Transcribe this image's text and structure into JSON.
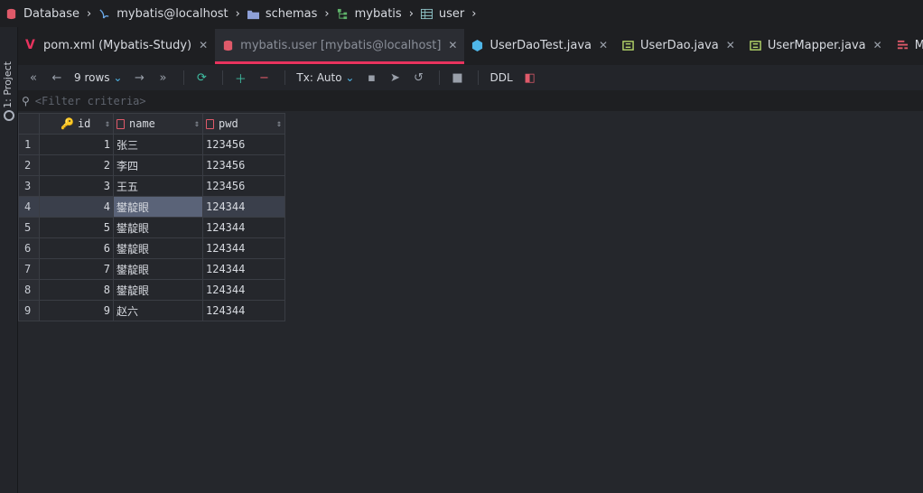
{
  "breadcrumb": {
    "items": [
      {
        "label": "Database",
        "icon": "database-icon"
      },
      {
        "label": "mybatis@localhost",
        "icon": "datasource-icon"
      },
      {
        "label": "schemas",
        "icon": "folder-icon"
      },
      {
        "label": "mybatis",
        "icon": "schema-icon"
      },
      {
        "label": "user",
        "icon": "table-icon"
      }
    ]
  },
  "sidebar": {
    "project_label": "1: Project"
  },
  "tabs": [
    {
      "label": "pom.xml (Mybatis-Study)",
      "icon": "maven-icon",
      "active": false
    },
    {
      "label": "mybatis.user [mybatis@localhost]",
      "icon": "database-icon",
      "active": true
    },
    {
      "label": "UserDaoTest.java",
      "icon": "java-test-icon",
      "active": false
    },
    {
      "label": "UserDao.java",
      "icon": "interface-icon",
      "active": false
    },
    {
      "label": "UserMapper.java",
      "icon": "interface-icon",
      "active": false
    },
    {
      "label": "Mybatis-config.xml",
      "icon": "xml-icon",
      "active": false
    }
  ],
  "toolbar": {
    "rows_label": "9 rows",
    "tx_label": "Tx: Auto",
    "ddl_label": "DDL"
  },
  "filter": {
    "placeholder": "<Filter criteria>"
  },
  "grid": {
    "columns": [
      {
        "name": "id",
        "icon": "key-icon"
      },
      {
        "name": "name",
        "icon": "column-icon"
      },
      {
        "name": "pwd",
        "icon": "column-icon"
      }
    ],
    "rows": [
      {
        "n": "1",
        "id": "1",
        "name": "张三",
        "pwd": "123456"
      },
      {
        "n": "2",
        "id": "2",
        "name": "李四",
        "pwd": "123456"
      },
      {
        "n": "3",
        "id": "3",
        "name": "王五",
        "pwd": "123456"
      },
      {
        "n": "4",
        "id": "4",
        "name": "鐢靛眼",
        "pwd": "124344"
      },
      {
        "n": "5",
        "id": "5",
        "name": "鐢靛眼",
        "pwd": "124344"
      },
      {
        "n": "6",
        "id": "6",
        "name": "鐢靛眼",
        "pwd": "124344"
      },
      {
        "n": "7",
        "id": "7",
        "name": "鐢靛眼",
        "pwd": "124344"
      },
      {
        "n": "8",
        "id": "8",
        "name": "鐢靛眼",
        "pwd": "124344"
      },
      {
        "n": "9",
        "id": "9",
        "name": "赵六",
        "pwd": "124344"
      }
    ],
    "selected_row": 4
  },
  "colors": {
    "accent": "#e8335e",
    "selected": "#5a6378"
  }
}
